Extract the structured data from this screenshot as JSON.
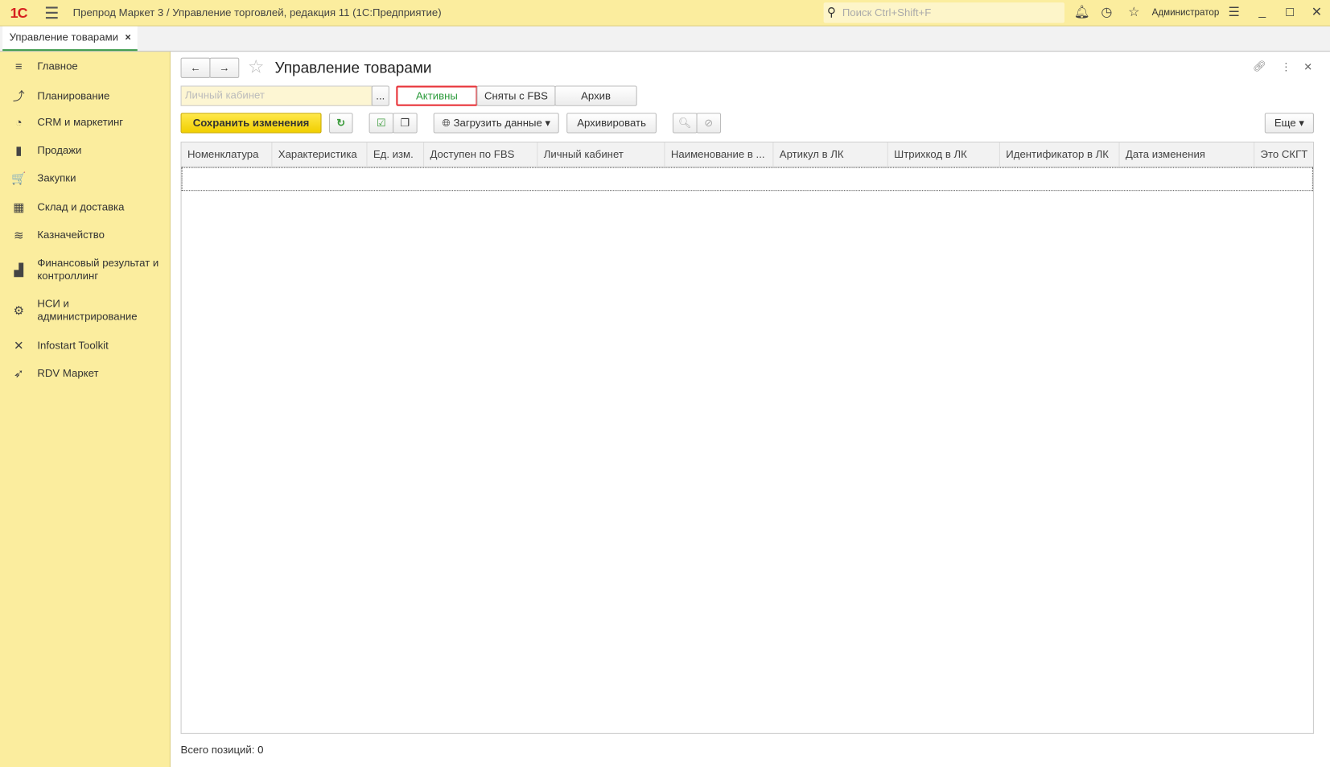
{
  "titlebar": {
    "logo": "1С",
    "title": "Препрод Маркет 3 / Управление торговлей, редакция 11  (1С:Предприятие)",
    "search_placeholder": "Поиск Ctrl+Shift+F",
    "user": "Администратор"
  },
  "tabs": [
    {
      "label": "Управление товарами",
      "close": "×"
    }
  ],
  "sidebar": {
    "items": [
      {
        "label": "Главное",
        "icon": "≡"
      },
      {
        "label": "Планирование",
        "icon": "⤴"
      },
      {
        "label": "CRM и маркетинг",
        "icon": "◔"
      },
      {
        "label": "Продажи",
        "icon": "▮"
      },
      {
        "label": "Закупки",
        "icon": "🛒"
      },
      {
        "label": "Склад и доставка",
        "icon": "▦"
      },
      {
        "label": "Казначейство",
        "icon": "≋"
      },
      {
        "label": "Финансовый результат и контроллинг",
        "icon": "▟"
      },
      {
        "label": "НСИ и администрирование",
        "icon": "⚙"
      },
      {
        "label": "Infostart Toolkit",
        "icon": "✕"
      },
      {
        "label": "RDV Маркет",
        "icon": "➶"
      }
    ]
  },
  "form": {
    "title": "Управление товарами",
    "cabinet_placeholder": "Личный кабинет",
    "select_btn": "...",
    "filter_tabs": [
      "Активны",
      "Сняты с FBS",
      "Архив"
    ],
    "save": "Сохранить изменения",
    "load": "Загрузить данные",
    "archive": "Архивировать",
    "more": "Еще",
    "columns": [
      "Номенклатура",
      "Характеристика",
      "Ед. изм.",
      "Доступен по FBS",
      "Личный кабинет",
      "Наименование в ...",
      "Артикул в ЛК",
      "Штрихкод в ЛК",
      "Идентификатор в ЛК",
      "Дата изменения",
      "Это СКГТ"
    ],
    "total_label": "Всего позиций:",
    "total_value": "0"
  },
  "colors": {
    "accent": "#fbed9e",
    "save": "#f5d600",
    "highlight": "#e8343a"
  }
}
